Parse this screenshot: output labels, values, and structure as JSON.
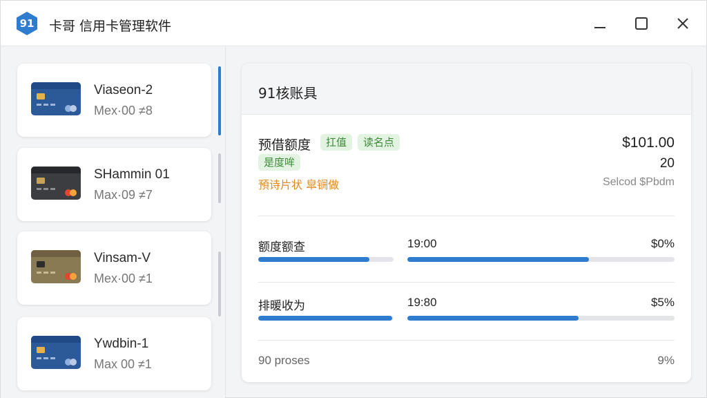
{
  "app": {
    "logo_text": "91",
    "title": "卡哥 信用卡管理软件"
  },
  "sidebar": {
    "cards": [
      {
        "name": "Viasеon-2",
        "sub": "Mex·00 ≠8",
        "style": "blue"
      },
      {
        "name": "SHammin 01",
        "sub": "Max·09 ≠7",
        "style": "dark"
      },
      {
        "name": "Vinsam-V",
        "sub": "Mex·00 ≠1",
        "style": "gold"
      },
      {
        "name": "Ywdbin-1",
        "sub": "Max 00 ≠1",
        "style": "blue"
      }
    ]
  },
  "panel": {
    "title": "91核账具",
    "credit_label": "预借额度",
    "tags": [
      "扛值",
      "读名点"
    ],
    "status_tag": "是度哞",
    "warning": "預诗片状 皐锎做",
    "amount": "$101.00",
    "count": "20",
    "select_text": "Selcod $Pbdm",
    "rows": [
      {
        "label": "额度额查",
        "time": "19:00",
        "percent": "$0%",
        "bar1": 0.82,
        "bar2": 0.68
      },
      {
        "label": "排暖收为",
        "time": "19:80",
        "percent": "$5%",
        "bar1": 0.99,
        "bar2": 0.64
      }
    ],
    "footer_left": "90 proses",
    "footer_right": "9%"
  },
  "colors": {
    "accent": "#2f7ccf",
    "tag_bg": "#e3f3e1",
    "tag_text": "#3e8a3a",
    "warning": "#e08a1e"
  }
}
